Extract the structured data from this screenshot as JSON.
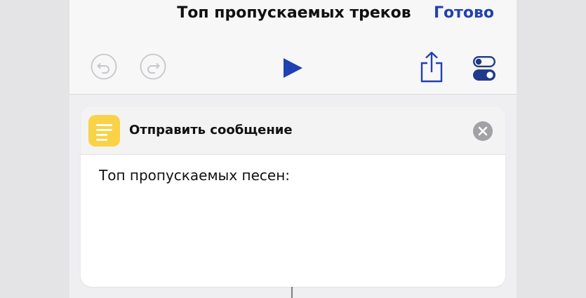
{
  "navbar": {
    "title": "Топ пропускаемых треков",
    "done_label": "Готово"
  },
  "toolbar": {
    "icons": [
      "undo-icon",
      "redo-icon",
      "play-icon",
      "share-icon",
      "settings-toggle-icon"
    ]
  },
  "action": {
    "title": "Отправить сообщение",
    "message": "Топ пропускаемых песен:",
    "icon": "text-icon"
  },
  "colors": {
    "accent": "#2041b3",
    "icon_tile": "#fad248",
    "disabled_icon": "#c7c7cc",
    "remove_icon": "#a1a1a6"
  }
}
